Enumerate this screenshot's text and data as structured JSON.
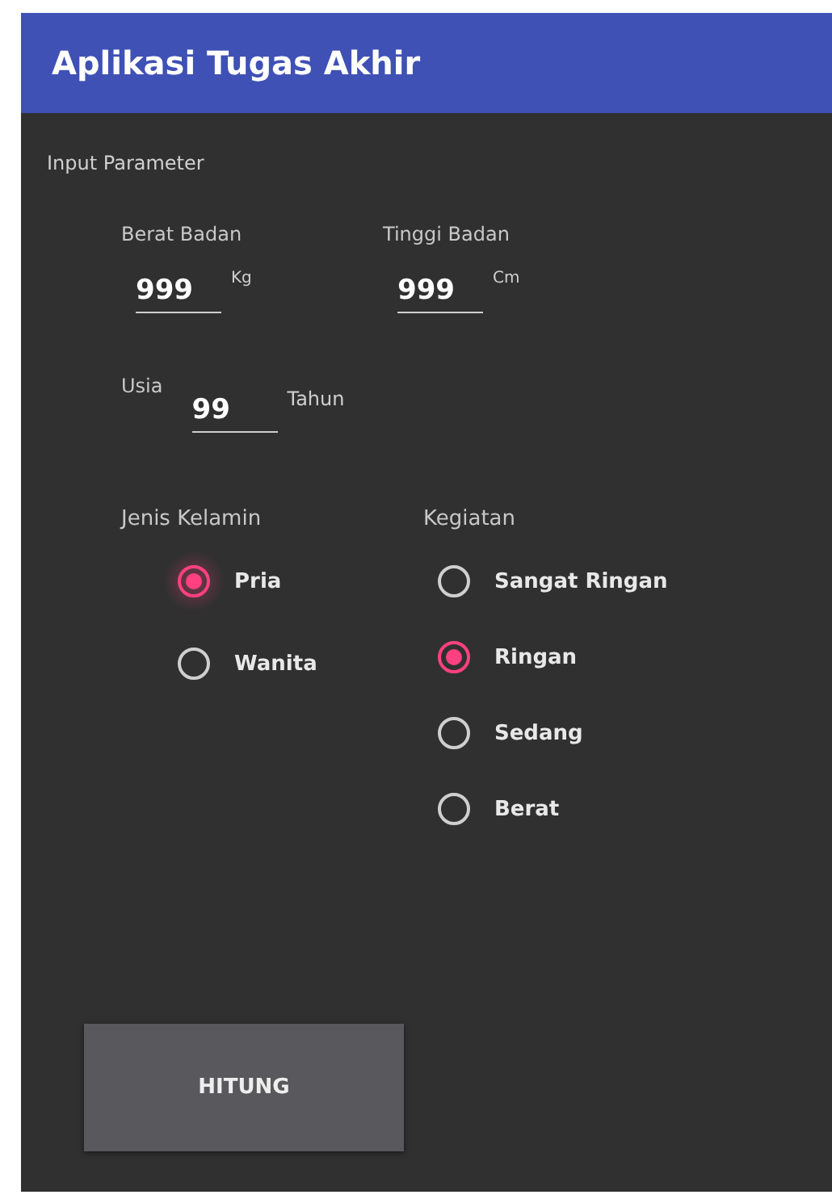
{
  "app_bar": {
    "title": "Aplikasi Tugas Akhir"
  },
  "section_label": "Input Parameter",
  "fields": [
    {
      "kind": "stacked",
      "label": "Berat Badan",
      "value": "999",
      "unit": "Kg"
    },
    {
      "kind": "stacked",
      "label": "Tinggi Badan",
      "value": "999",
      "unit": "Cm"
    },
    {
      "kind": "inline",
      "label": "Usia",
      "value": "99",
      "unit": "Tahun"
    }
  ],
  "radio_groups": [
    {
      "label": "Jenis Kelamin",
      "options": [
        {
          "label": "Pria",
          "selected": true,
          "focused": true
        },
        {
          "label": "Wanita",
          "selected": false,
          "focused": false
        }
      ]
    },
    {
      "label": "Kegiatan",
      "options": [
        {
          "label": "Sangat Ringan",
          "selected": false,
          "focused": false
        },
        {
          "label": "Ringan",
          "selected": true,
          "focused": false
        },
        {
          "label": "Sedang",
          "selected": false,
          "focused": false
        },
        {
          "label": "Berat",
          "selected": false,
          "focused": false
        }
      ]
    }
  ],
  "button": {
    "label": "HITUNG"
  }
}
